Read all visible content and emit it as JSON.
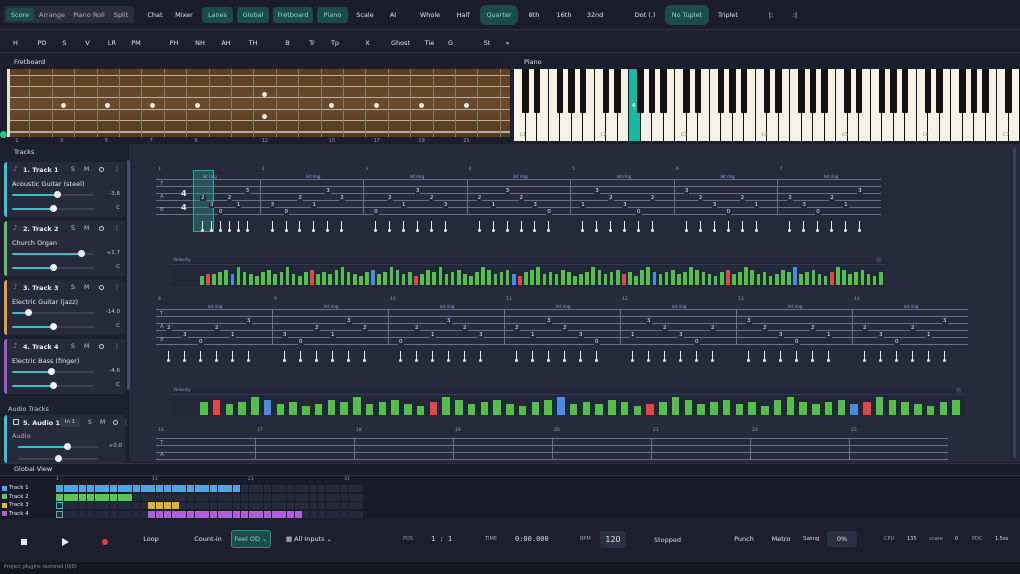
{
  "toolbar": {
    "view_tabs": [
      "Score",
      "Arrange",
      "Piano Roll",
      "Split"
    ],
    "panels": [
      "Chat",
      "Mixer",
      "Lanes",
      "Global",
      "Fretboard",
      "Piano",
      "Scale",
      "AI"
    ],
    "durations": [
      "Whole",
      "Half",
      "Quarter",
      "8th",
      "16th",
      "32nd"
    ],
    "dot": "Dot (.)",
    "tuplet": "No Tuplet",
    "triplet": "Triplet",
    "bar_symbols": [
      "|:",
      ":|"
    ]
  },
  "techniques": [
    "H",
    "PO",
    "S",
    "V",
    "LR",
    "PM",
    "PH",
    "NH",
    "AH",
    "TH",
    "B",
    "Tr",
    "Tp",
    "X",
    "Ghost",
    "Tie",
    "G",
    "St",
    "»"
  ],
  "fretboard": {
    "title": "Fretboard",
    "frets": [
      "1",
      "3",
      "5",
      "7",
      "9",
      "12",
      "15",
      "17",
      "19",
      "21"
    ]
  },
  "piano": {
    "title": "Piano",
    "octaves": [
      "C1",
      "C2",
      "C3",
      "C4",
      "C5",
      "C6",
      "C7"
    ],
    "active_key": "4"
  },
  "tracks_panel": {
    "title": "Tracks",
    "tracks": [
      {
        "name": "1. Track 1",
        "instrument": "Acoustic Guitar (steel)",
        "volume": "-3.6",
        "pan": "C",
        "color": "#38c6d4",
        "vol_level": 0.55,
        "pan_level": 0.5
      },
      {
        "name": "2. Track 2",
        "instrument": "Church Organ",
        "volume": "+1.7",
        "pan": "C",
        "color": "#5cc45c",
        "vol_level": 0.85,
        "pan_level": 0.5
      },
      {
        "name": "3. Track 3",
        "instrument": "Electric Guitar (jazz)",
        "volume": "-14.0",
        "pan": "C",
        "color": "#e0a03a",
        "vol_level": 0.2,
        "pan_level": 0.5
      },
      {
        "name": "4. Track 4",
        "instrument": "Electric Bass (finger)",
        "volume": "-4.6",
        "pan": "C",
        "color": "#a05ad0",
        "vol_level": 0.48,
        "pan_level": 0.5
      }
    ],
    "sm_labels": [
      "S",
      "M"
    ],
    "audio_title": "Audio Tracks",
    "audio": {
      "name": "5. Audio 1",
      "input": "In 1",
      "instrument": "Audio",
      "volume": "+0.0",
      "color": "#38c6d4"
    }
  },
  "score": {
    "lane_label": "Velocity",
    "tab_letters": [
      "T",
      "A",
      "B"
    ],
    "time_sig": [
      "4",
      "4"
    ],
    "annotation": "let ring",
    "system1_bars": [
      "1",
      "2",
      "3",
      "4",
      "5",
      "6",
      "7"
    ],
    "system2_bars": [
      "8",
      "9",
      "10",
      "11",
      "12",
      "13",
      "14"
    ],
    "system3_bars": [
      "16",
      "17",
      "18",
      "19",
      "20",
      "21",
      "22",
      "23"
    ],
    "system1_velocities": [
      4,
      5,
      5,
      6,
      7,
      5,
      8,
      6,
      5,
      4,
      6,
      7,
      5,
      6,
      8,
      5,
      4,
      6,
      7,
      5,
      6,
      5,
      7,
      8,
      6,
      5,
      4,
      6,
      7,
      5,
      6,
      8,
      7,
      5,
      6,
      4,
      5,
      7,
      6,
      8,
      5,
      6,
      7,
      5,
      4,
      6,
      8,
      7,
      5,
      6,
      7,
      5,
      4,
      6,
      7,
      8,
      5,
      6,
      5,
      7,
      6,
      4,
      5,
      6,
      8,
      7,
      5,
      6,
      7,
      5,
      6,
      4,
      7,
      8,
      6,
      5,
      6,
      7,
      5,
      6,
      8,
      7,
      6,
      5,
      4,
      6,
      7,
      5,
      6,
      8,
      7,
      5,
      6,
      4,
      5,
      7,
      6,
      8,
      5,
      6,
      7,
      5,
      4,
      6,
      8,
      7,
      5,
      6,
      7,
      5,
      4,
      6
    ],
    "system2_velocities": [
      6,
      7,
      5,
      6,
      8,
      7,
      5,
      6,
      4,
      5,
      7,
      6,
      8,
      5,
      6,
      7,
      5,
      4,
      6,
      8,
      7,
      5,
      6,
      7,
      5,
      4,
      6,
      7,
      8,
      5,
      6,
      5,
      7,
      6,
      4,
      5,
      6,
      8,
      7,
      5,
      6,
      7,
      5,
      6,
      4,
      7,
      8,
      6,
      5,
      6,
      7,
      5,
      6,
      8,
      7,
      6,
      5,
      4,
      6,
      7
    ]
  },
  "global_view": {
    "title": "Global View",
    "markers": [
      "1",
      "11",
      "21",
      "31"
    ],
    "rows": [
      {
        "name": "Track 1",
        "color": "#4aa8e8"
      },
      {
        "name": "Track 2",
        "color": "#5cc45c"
      },
      {
        "name": "Track 3",
        "color": "#e0b03a"
      },
      {
        "name": "Track 4",
        "color": "#b060d8"
      }
    ]
  },
  "transport": {
    "loop": "Loop",
    "count_in": "Count-in",
    "feel": "Feel OD",
    "inputs": "All Inputs",
    "pos_label": "POS",
    "pos": "1 : 1",
    "time_label": "TIME",
    "time": "0:00.000",
    "bpm_label": "BPM",
    "bpm": "120",
    "status": "Stopped",
    "punch": "Punch",
    "metro": "Metro",
    "swing_label": "Swing",
    "swing": "0%",
    "cpu_label": "CPU",
    "cpu": "135",
    "snare": "snare",
    "snare_val": "0",
    "pdc_label": "PDC",
    "pdc": "1.5ss"
  },
  "status_bar": "Project plugins restored (0/0)"
}
